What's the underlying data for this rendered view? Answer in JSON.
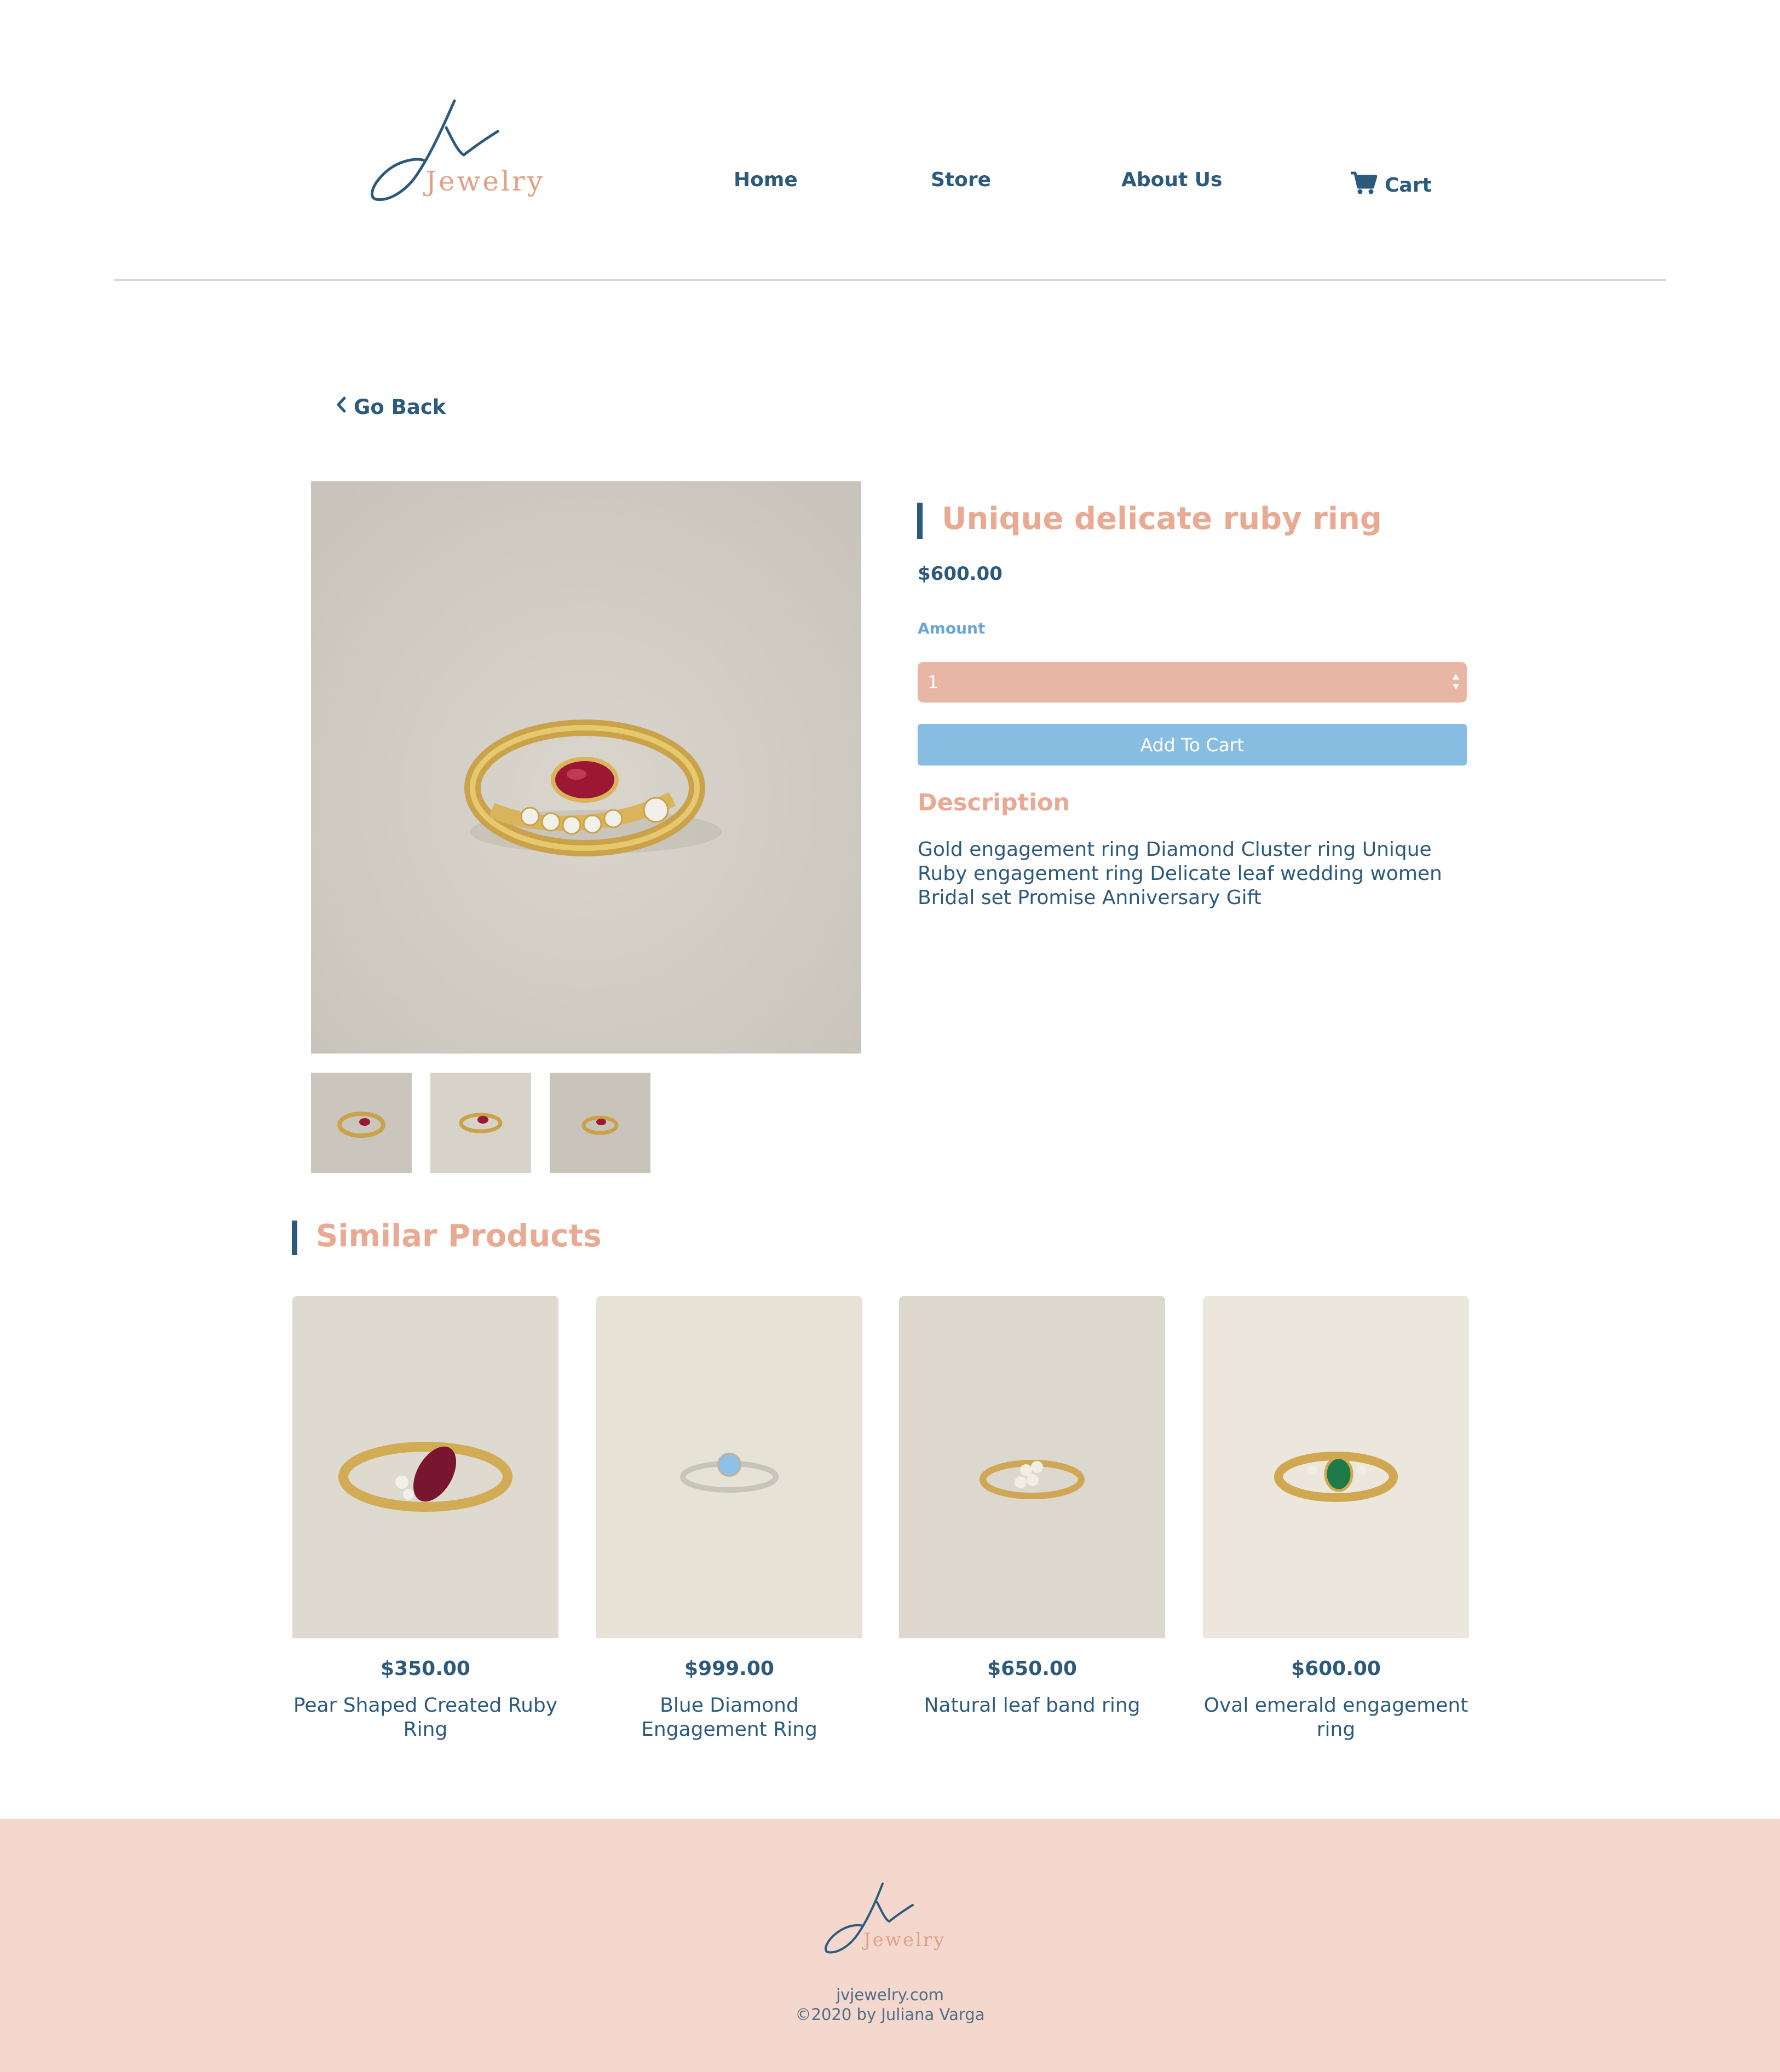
{
  "brand": {
    "logo_letters": "Jv",
    "logo_word": "Jewelry"
  },
  "nav": {
    "home": "Home",
    "store": "Store",
    "about": "About Us",
    "cart": "Cart",
    "cart_icon": "cart-icon"
  },
  "go_back": {
    "label": "Go Back",
    "icon": "chevron-left-icon"
  },
  "product": {
    "title": "Unique delicate ruby ring",
    "price": "$600.00",
    "amount_label": "Amount",
    "amount_value": "1",
    "add_to_cart": "Add To Cart",
    "description_heading": "Description",
    "description": "Gold engagement ring Diamond Cluster ring Unique Ruby engagement ring Delicate leaf wedding women Bridal set Promise Anniversary Gift"
  },
  "similar": {
    "heading": "Similar Products",
    "items": [
      {
        "price": "$350.00",
        "name": "Pear Shaped Created Ruby Ring"
      },
      {
        "price": "$999.00",
        "name": "Blue Diamond Engagement Ring"
      },
      {
        "price": "$650.00",
        "name": "Natural leaf band ring"
      },
      {
        "price": "$600.00",
        "name": "Oval emerald engagement ring"
      }
    ]
  },
  "footer": {
    "site": "jvjewelry.com",
    "copyright": "©2020 by Juliana Varga"
  },
  "colors": {
    "navy": "#2c5a7c",
    "peach": "#e8aa92",
    "blue": "#86bde1",
    "footer_bg": "#f4d8ce"
  }
}
